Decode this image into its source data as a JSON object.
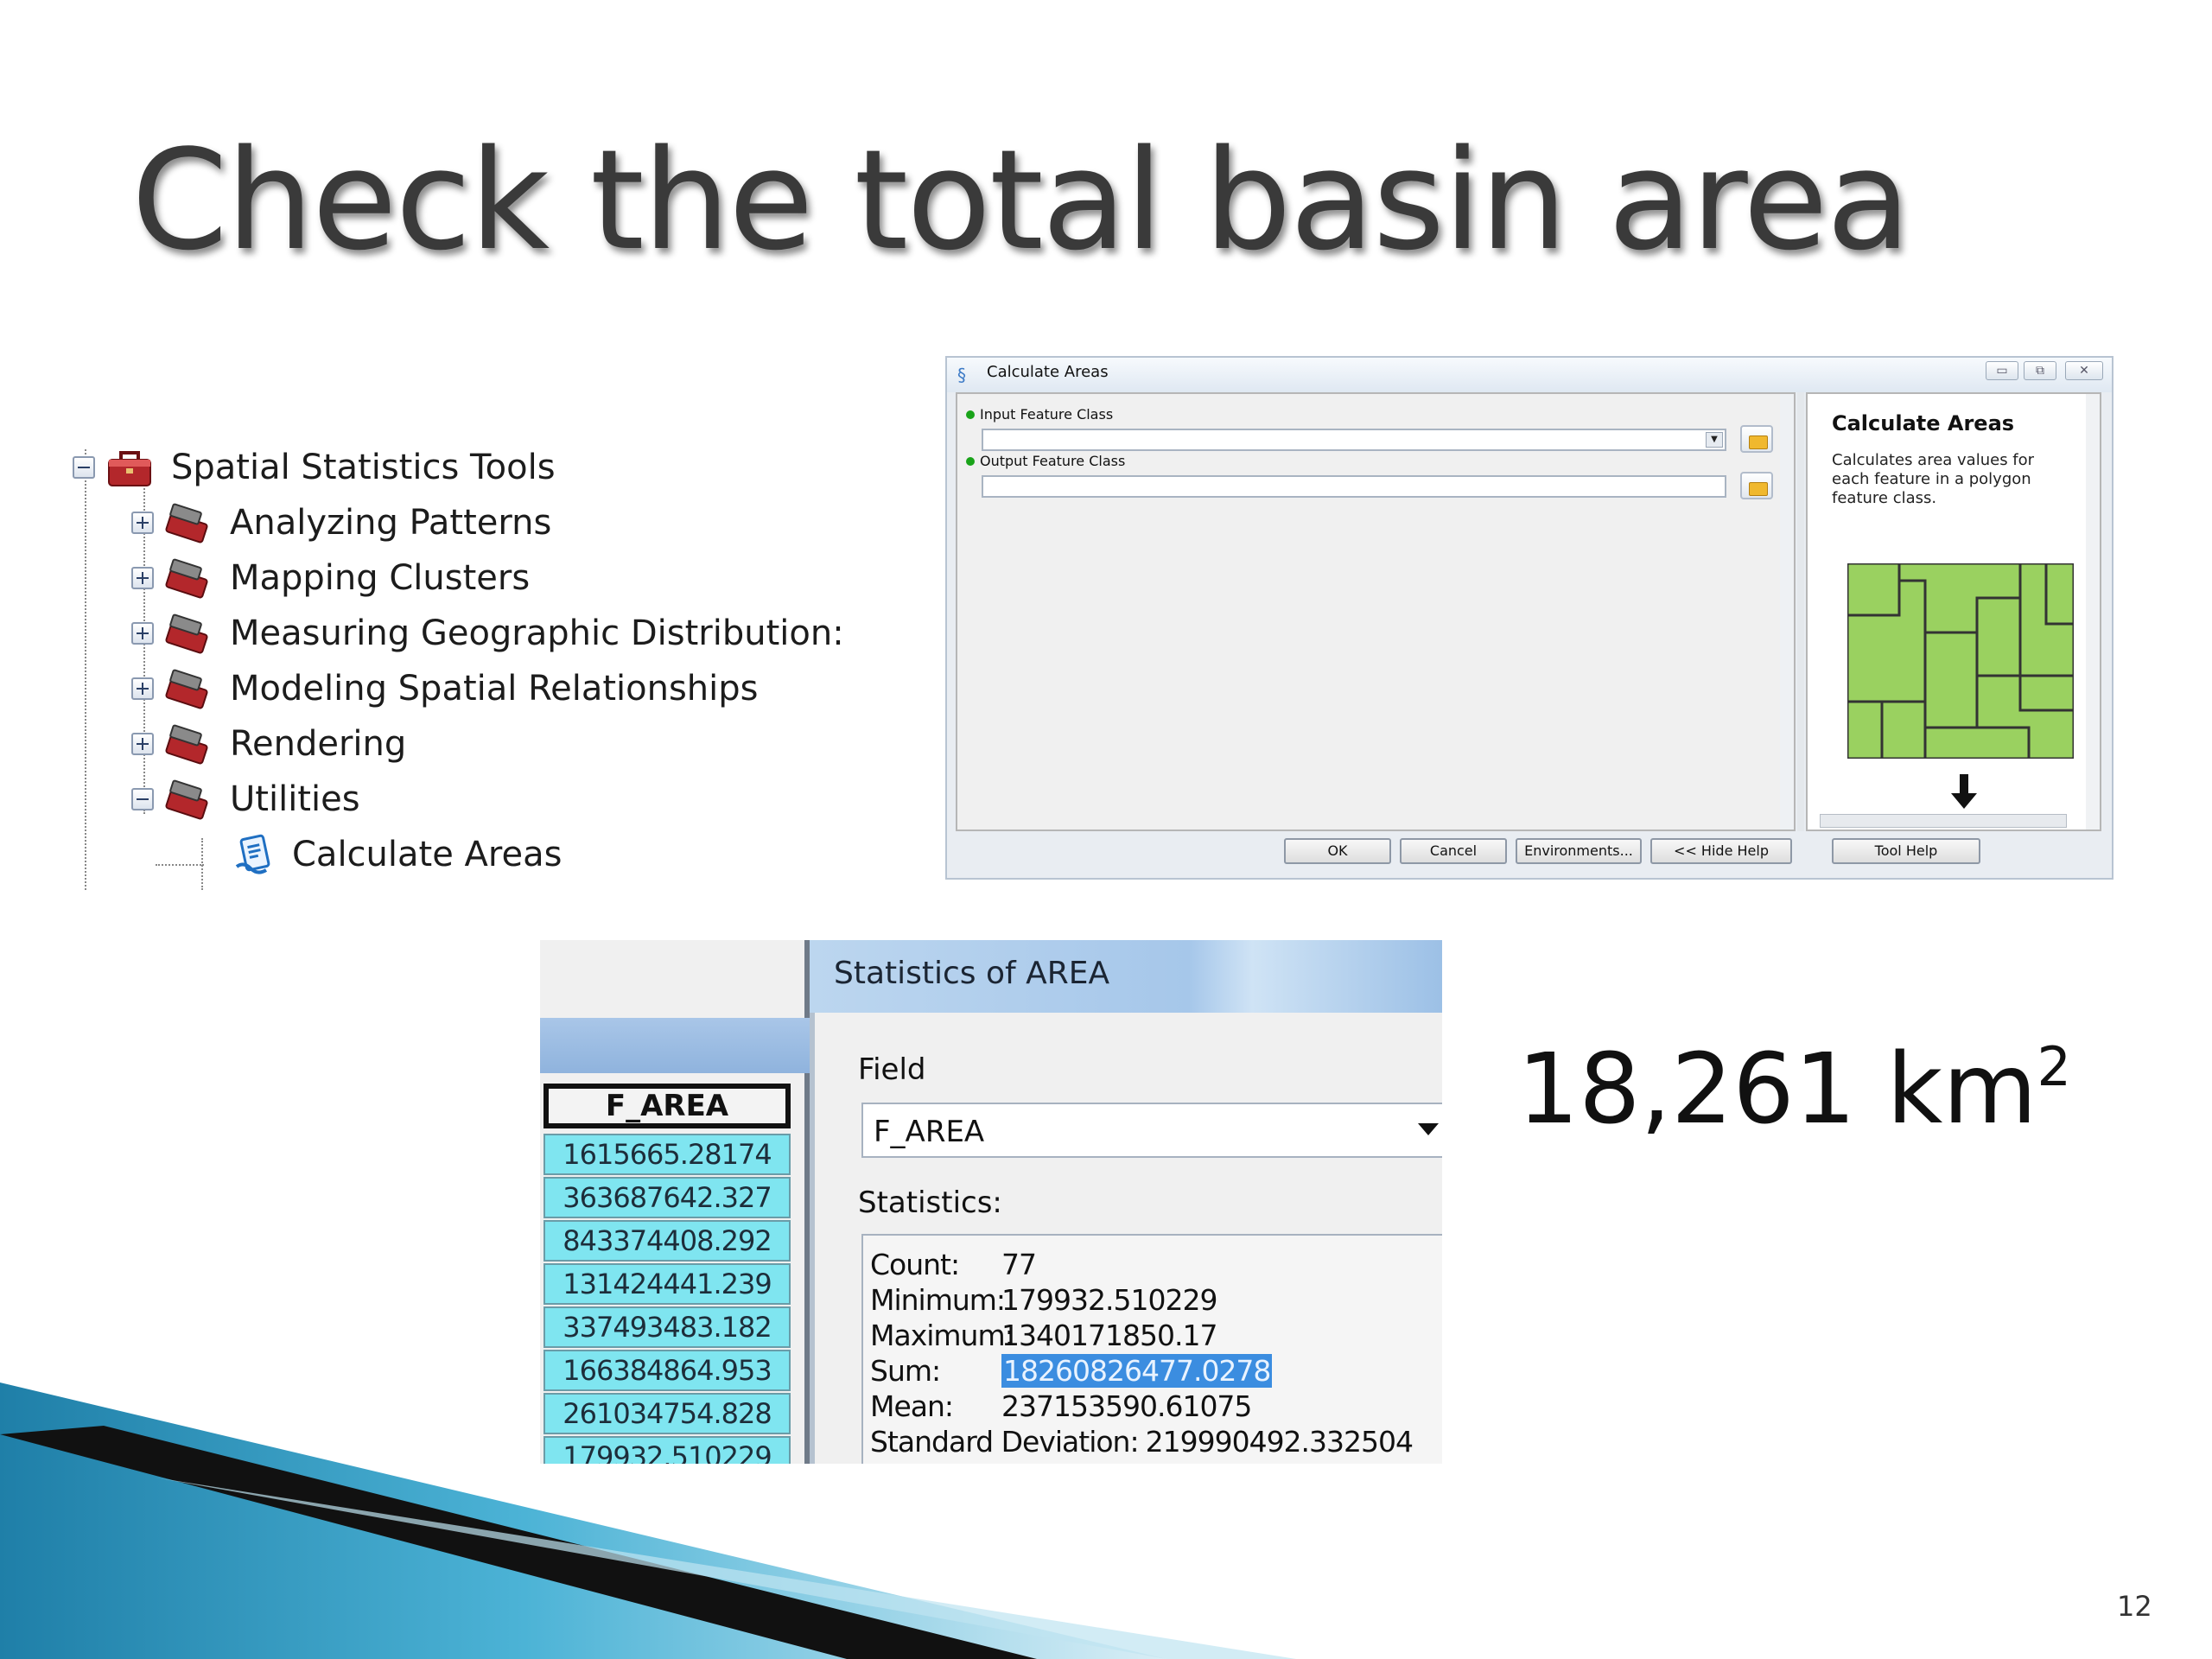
{
  "slide": {
    "title": "Check the total basin area",
    "page_number": "12"
  },
  "tree": {
    "root": "Spatial Statistics Tools",
    "items": [
      {
        "label": "Analyzing Patterns",
        "expander": "plus"
      },
      {
        "label": "Mapping Clusters",
        "expander": "plus"
      },
      {
        "label": "Measuring Geographic Distribution:",
        "expander": "plus"
      },
      {
        "label": "Modeling Spatial Relationships",
        "expander": "plus"
      },
      {
        "label": "Rendering",
        "expander": "plus"
      },
      {
        "label": "Utilities",
        "expander": "minus"
      }
    ],
    "leaf": "Calculate Areas"
  },
  "calc_dialog": {
    "title": "Calculate Areas",
    "input_label": "Input Feature Class",
    "output_label": "Output Feature Class",
    "help_title": "Calculate Areas",
    "help_text": "Calculates area values for each feature in a polygon feature class.",
    "buttons": {
      "ok": "OK",
      "cancel": "Cancel",
      "environments": "Environments...",
      "hide_help": "<< Hide Help",
      "tool_help": "Tool Help"
    }
  },
  "table": {
    "column": "F_AREA",
    "values": [
      "1615665.28174",
      "363687642.327",
      "843374408.292",
      "131424441.239",
      "337493483.182",
      "166384864.953",
      "261034754.828",
      "179932.510229"
    ]
  },
  "stats_dialog": {
    "title": "Statistics of AREA",
    "field_label": "Field",
    "field_value": "F_AREA",
    "statistics_label": "Statistics:",
    "count_label": "Count:",
    "count": "77",
    "minimum_label": "Minimum:",
    "minimum": "179932.510229",
    "maximum_label": "Maximum:",
    "maximum": "1340171850.17",
    "sum_label": "Sum:",
    "sum": "18260826477.0278",
    "mean_label": "Mean:",
    "mean": "237153590.61075",
    "sd_label": "Standard Deviation:",
    "sd": "219990492.332504"
  },
  "result": {
    "value": "18,261 km",
    "exponent": "2"
  },
  "colors": {
    "title": "#3a3a3a",
    "table_cell": "#7fe5f0",
    "highlight": "#3b8de0",
    "map_fill": "#9ad160",
    "deco_blue": "#2a8fb8"
  }
}
